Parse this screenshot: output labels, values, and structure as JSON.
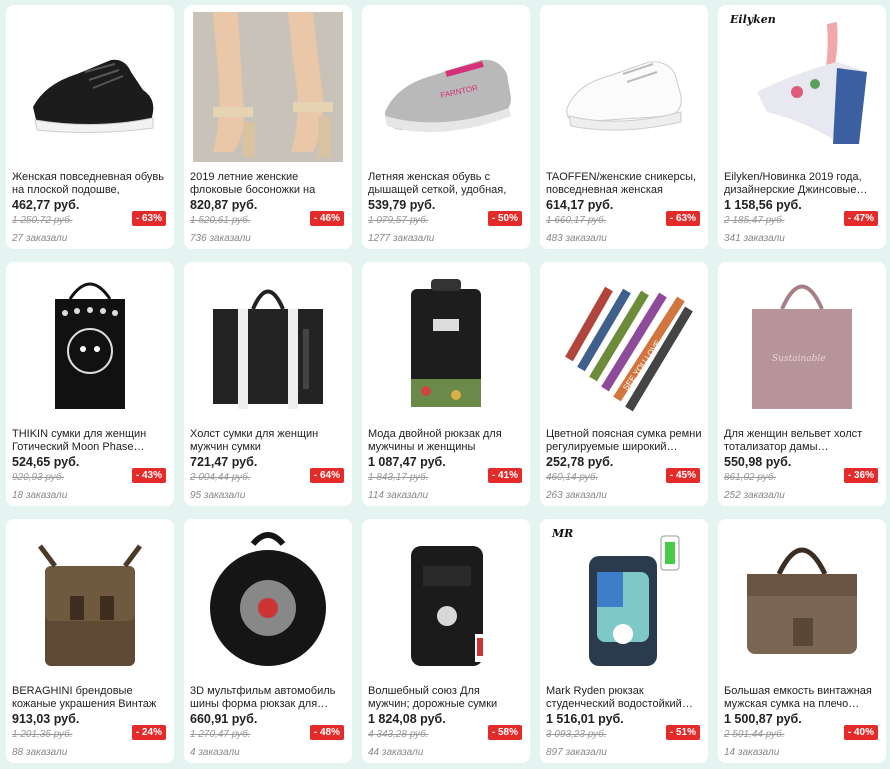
{
  "products": [
    {
      "title": "Женская повседневная обувь на плоской подошве, дышащ…",
      "price": "462,77 руб.",
      "old_price": "1 250,72 руб.",
      "discount": "- 63%",
      "orders": "27 заказали",
      "image": "black-sneaker",
      "brand": ""
    },
    {
      "title": "2019 летние женские флоковые босоножки на квадратном…",
      "price": "820,87 руб.",
      "old_price": "1 520,61 руб.",
      "discount": "- 46%",
      "orders": "736 заказали",
      "image": "heeled-sandals",
      "brand": ""
    },
    {
      "title": "Летняя женская обувь с дышащей сеткой, удобная, на…",
      "price": "539,79 руб.",
      "old_price": "1 079,57 руб.",
      "discount": "- 50%",
      "orders": "1277 заказали",
      "image": "grey-mesh-shoe",
      "brand": ""
    },
    {
      "title": "TAOFFEN/женские сникерсы, повседневная женская обувь…",
      "price": "614,17 руб.",
      "old_price": "1 660,17 руб.",
      "discount": "- 63%",
      "orders": "483 заказали",
      "image": "white-sneaker",
      "brand": ""
    },
    {
      "title": "Eilyken/Новинка 2019 года, дизайнерские Джинсовые…",
      "price": "1 158,56 руб.",
      "old_price": "2 185,47 руб.",
      "discount": "- 47%",
      "orders": "341 заказали",
      "image": "denim-wedge",
      "brand": "Eilyken"
    },
    {
      "title": "THIKIN сумки для женщин Готический Moon Phase…",
      "price": "524,65 руб.",
      "old_price": "920,93 руб.",
      "discount": "- 43%",
      "orders": "18 заказали",
      "image": "cat-tote",
      "brand": ""
    },
    {
      "title": "Холст сумки для женщин мужчин сумки многоразового…",
      "price": "721,47 руб.",
      "old_price": "2 004,44 руб.",
      "discount": "- 64%",
      "orders": "95 заказали",
      "image": "black-canvas-tote",
      "brand": ""
    },
    {
      "title": "Мода двойной рюкзак для мужчины и женщины модная…",
      "price": "1 087,47 руб.",
      "old_price": "1 843,17 руб.",
      "discount": "- 41%",
      "orders": "114 заказали",
      "image": "black-backpack",
      "brand": ""
    },
    {
      "title": "Цветной поясная сумка ремни регулируемые широкий…",
      "price": "252,78 руб.",
      "old_price": "460,14 руб.",
      "discount": "- 45%",
      "orders": "263 заказали",
      "image": "bag-straps",
      "brand": ""
    },
    {
      "title": "Для женщин вельвет холст тотализатор дамы…",
      "price": "550,98 руб.",
      "old_price": "861,02 руб.",
      "discount": "- 36%",
      "orders": "252 заказали",
      "image": "pink-tote",
      "brand": ""
    },
    {
      "title": "BERAGHINI брендовые кожаные украшения Винтаж Для мужч…",
      "price": "913,03 руб.",
      "old_price": "1 201,35 руб.",
      "discount": "- 24%",
      "orders": "88 заказали",
      "image": "leather-messenger",
      "brand": ""
    },
    {
      "title": "3D мультфильм автомобиль шины форма рюкзак для…",
      "price": "660,91 руб.",
      "old_price": "1 270,47 руб.",
      "discount": "- 48%",
      "orders": "4 заказали",
      "image": "tire-backpack",
      "brand": ""
    },
    {
      "title": "Волшебный союз Для мужчин; дорожные сумки моды Для…",
      "price": "1 824,08 руб.",
      "old_price": "4 343,28 руб.",
      "discount": "- 58%",
      "orders": "44 заказали",
      "image": "travel-backpack",
      "brand": ""
    },
    {
      "title": "Mark Ryden рюкзак студенческий водостойкий…",
      "price": "1 516,01 руб.",
      "old_price": "3 093,23 руб.",
      "discount": "- 51%",
      "orders": "897 заказали",
      "image": "usb-backpack",
      "brand": "MR"
    },
    {
      "title": "Большая емкость винтажная мужская сумка на плечо…",
      "price": "1 500,87 руб.",
      "old_price": "2 501,44 руб.",
      "discount": "- 40%",
      "orders": "14 заказали",
      "image": "canvas-handbag",
      "brand": ""
    }
  ],
  "colors": {
    "discount": "#e52a2a",
    "background": "#e6f4f1"
  }
}
